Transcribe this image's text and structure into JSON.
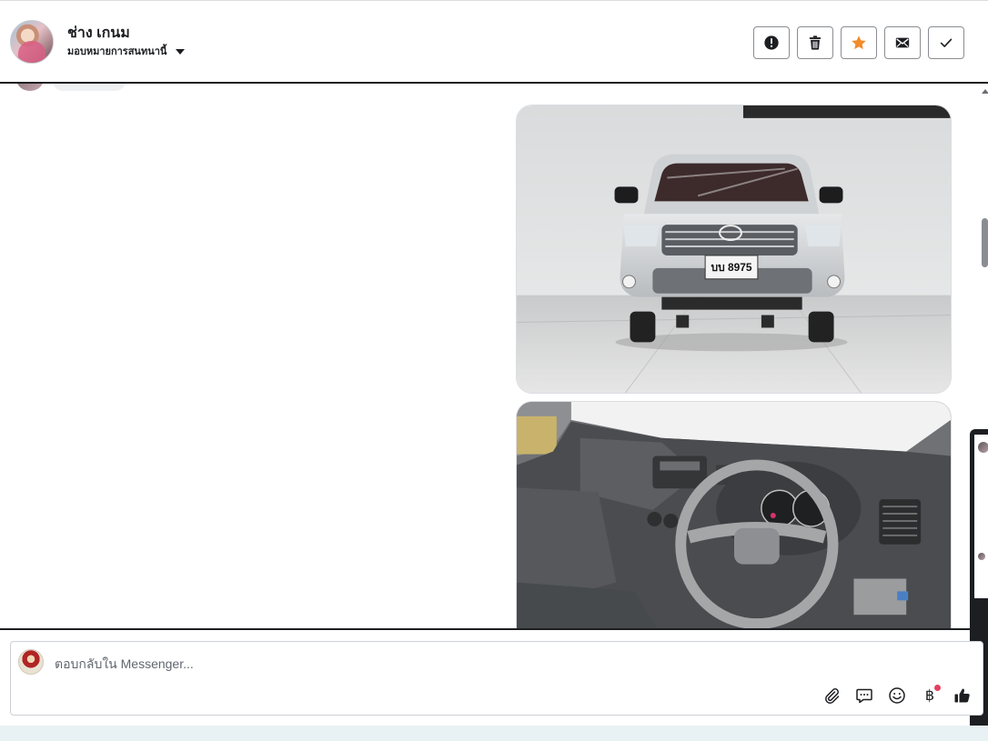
{
  "header": {
    "contact_name": "ช่าง เกนม",
    "assign_label": "มอบหมายการสนทนานี้",
    "actions": [
      {
        "name": "mark-spam-button",
        "icon": "alert-circle-icon"
      },
      {
        "name": "delete-button",
        "icon": "trash-icon"
      },
      {
        "name": "star-button",
        "icon": "star-icon",
        "color": "#f28c28"
      },
      {
        "name": "mark-unread-button",
        "icon": "envelope-icon"
      },
      {
        "name": "mark-done-button",
        "icon": "check-icon"
      }
    ]
  },
  "thread": {
    "attachments": [
      {
        "icon": "car-front-photo",
        "plate": "บบ 8975"
      },
      {
        "icon": "car-interior-photo"
      }
    ]
  },
  "composer": {
    "placeholder": "ตอบกลับใน Messenger...",
    "tools": [
      "attach-icon",
      "saved-reply-icon",
      "emoji-icon",
      "payment-baht-icon",
      "like-icon"
    ],
    "payment_glyph": "฿"
  },
  "colors": {
    "border_dark": "#1c1e21",
    "star": "#f28c28",
    "badge": "#e4405f",
    "strip": "#e8f1f4"
  }
}
